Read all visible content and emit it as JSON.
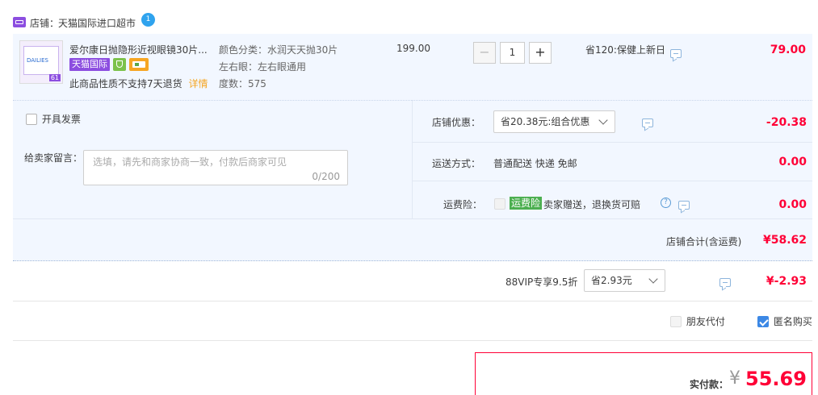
{
  "shop": {
    "label": "店铺：",
    "name": "天猫国际进口超市",
    "avatar_badge": "1"
  },
  "product": {
    "thumb_text": "DAILIES",
    "thumb_badge": "61",
    "title": "爱尔康日抛隐形近视眼镜30片...",
    "tag_tmall_intl": "天猫国际",
    "notice": "此商品性质不支持7天退货",
    "notice_link": "详情",
    "spec_color": "颜色分类：水润天天抛30片",
    "spec_eye": "左右眼：左右眼通用",
    "spec_degree": "度数：575",
    "unit_price": "199.00",
    "quantity": "1",
    "minus_label": "−",
    "plus_label": "+",
    "promo": "省120:保健上新日",
    "subtotal": "79.00"
  },
  "invoice": {
    "label": "开具发票"
  },
  "message": {
    "label": "给卖家留言：",
    "placeholder": "选填，请先和商家协商一致，付款后商家可见",
    "counter": "0/200"
  },
  "shop_discount": {
    "label": "店铺优惠：",
    "selected": "省20.38元:组合优惠",
    "amount": "-20.38"
  },
  "shipping": {
    "label": "运送方式：",
    "method": "普通配送 快递 免邮",
    "amount": "0.00"
  },
  "insurance": {
    "label": "运费险：",
    "tag": "运费险",
    "desc": "卖家赠送，退换货可赔",
    "amount": "0.00"
  },
  "shop_total": {
    "label": "店铺合计(含运费)",
    "amount": "¥58.62"
  },
  "vip": {
    "label": "88VIP专享9.5折",
    "selected": "省2.93元",
    "amount": "¥-2.93"
  },
  "options": {
    "friend_pay": "朋友代付",
    "anonymous": "匿名购买"
  },
  "payment": {
    "label": "实付款：",
    "currency": "¥",
    "amount": "55.69"
  },
  "colors": {
    "accent_red": "#ff0036",
    "tmall_purple": "#8c4ee0",
    "insurance_green": "#4caf50",
    "check_blue": "#3c88e5"
  }
}
